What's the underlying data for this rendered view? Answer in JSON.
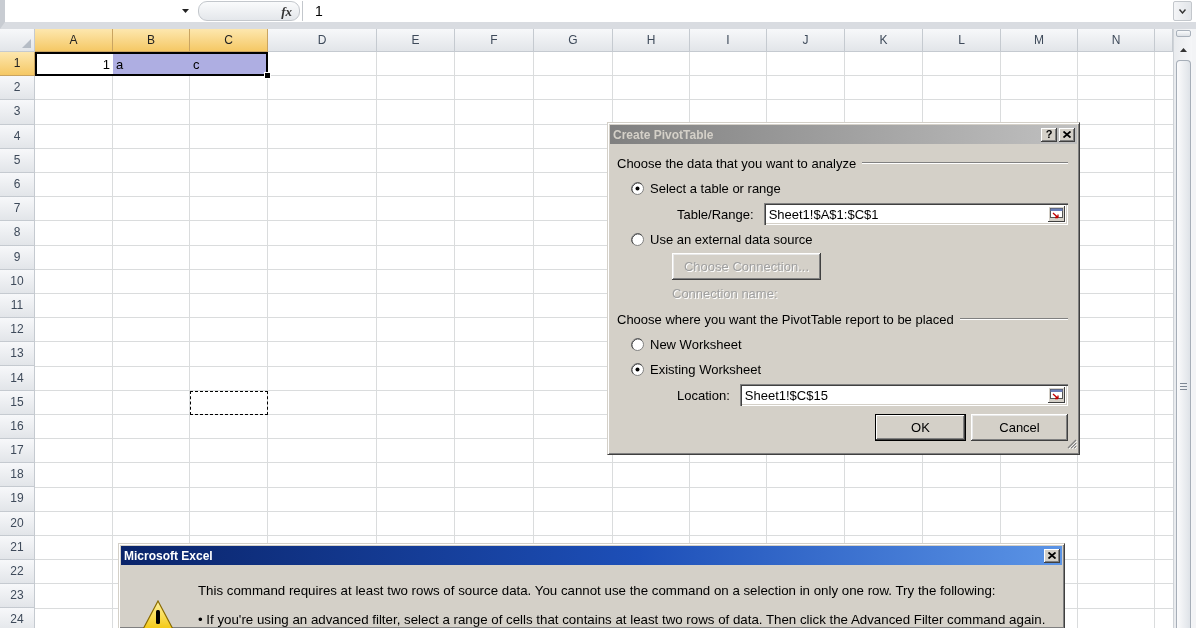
{
  "formula_bar": {
    "function_label": "fx",
    "formula": "1"
  },
  "sheet": {
    "columns": [
      {
        "label": "A",
        "selected": true
      },
      {
        "label": "B",
        "selected": true
      },
      {
        "label": "C",
        "selected": true
      },
      {
        "label": "D",
        "selected": false
      },
      {
        "label": "E",
        "selected": false
      },
      {
        "label": "F",
        "selected": false
      },
      {
        "label": "G",
        "selected": false
      },
      {
        "label": "H",
        "selected": false
      },
      {
        "label": "I",
        "selected": false
      },
      {
        "label": "J",
        "selected": false
      },
      {
        "label": "K",
        "selected": false
      },
      {
        "label": "L",
        "selected": false
      },
      {
        "label": "M",
        "selected": false
      },
      {
        "label": "N",
        "selected": false
      }
    ],
    "rows": [
      {
        "label": "1",
        "selected": true,
        "cells": [
          {
            "kind": "number",
            "text": "1",
            "selected": true,
            "active": true,
            "marquee": false
          },
          {
            "kind": "text",
            "text": "a",
            "selected": true,
            "active": false,
            "marquee": false
          },
          {
            "kind": "text",
            "text": "c",
            "selected": true,
            "active": false,
            "marquee": false
          }
        ]
      },
      {
        "label": "2",
        "selected": false
      },
      {
        "label": "3",
        "selected": false
      },
      {
        "label": "4",
        "selected": false
      },
      {
        "label": "5",
        "selected": false
      },
      {
        "label": "6",
        "selected": false
      },
      {
        "label": "7",
        "selected": false
      },
      {
        "label": "8",
        "selected": false
      },
      {
        "label": "9",
        "selected": false
      },
      {
        "label": "10",
        "selected": false
      },
      {
        "label": "11",
        "selected": false
      },
      {
        "label": "12",
        "selected": false
      },
      {
        "label": "13",
        "selected": false
      },
      {
        "label": "14",
        "selected": false
      },
      {
        "label": "15",
        "selected": false,
        "cells": [
          {
            "kind": "empty",
            "selected": false,
            "active": false,
            "marquee": false
          },
          {
            "kind": "empty",
            "selected": false,
            "active": false,
            "marquee": false
          },
          {
            "kind": "empty",
            "selected": false,
            "active": false,
            "marquee": true
          }
        ]
      },
      {
        "label": "16",
        "selected": false
      },
      {
        "label": "17",
        "selected": false
      },
      {
        "label": "18",
        "selected": false
      },
      {
        "label": "19",
        "selected": false
      },
      {
        "label": "20",
        "selected": false
      },
      {
        "label": "21",
        "selected": false
      },
      {
        "label": "22",
        "selected": false
      },
      {
        "label": "23",
        "selected": false
      },
      {
        "label": "24",
        "selected": false
      }
    ]
  },
  "pivot_dialog": {
    "title": "Create PivotTable",
    "active": false,
    "help_button": "?",
    "sections": [
      {
        "heading": "Choose the data that you want to analyze",
        "options": [
          {
            "kind": "radio",
            "label": "Select a table or range",
            "selected": true
          },
          {
            "kind": "field",
            "label": "Table/Range:",
            "value": "Sheet1!$A$1:$C$1"
          },
          {
            "kind": "radio",
            "label": "Use an external data source",
            "selected": false
          },
          {
            "kind": "button",
            "label": "Choose Connection...",
            "disabled": true
          },
          {
            "kind": "note",
            "label": "Connection name:",
            "disabled": true
          }
        ]
      },
      {
        "heading": "Choose where you want the PivotTable report to be placed",
        "options": [
          {
            "kind": "radio",
            "label": "New Worksheet",
            "selected": false
          },
          {
            "kind": "radio",
            "label": "Existing Worksheet",
            "selected": true
          },
          {
            "kind": "field",
            "label": "Location:",
            "value": "Sheet1!$C$15"
          }
        ]
      }
    ],
    "buttons": [
      {
        "label": "OK",
        "default": true
      },
      {
        "label": "Cancel",
        "default": false
      }
    ]
  },
  "alert_dialog": {
    "title": "Microsoft Excel",
    "active": true,
    "message": "This command requires at least two rows of source data. You cannot use the command on a selection in only one row. Try the following:",
    "bullets": [
      "• If you're using an advanced filter, select a range of cells that contains at least two rows of data. Then click the Advanced Filter command again."
    ]
  }
}
